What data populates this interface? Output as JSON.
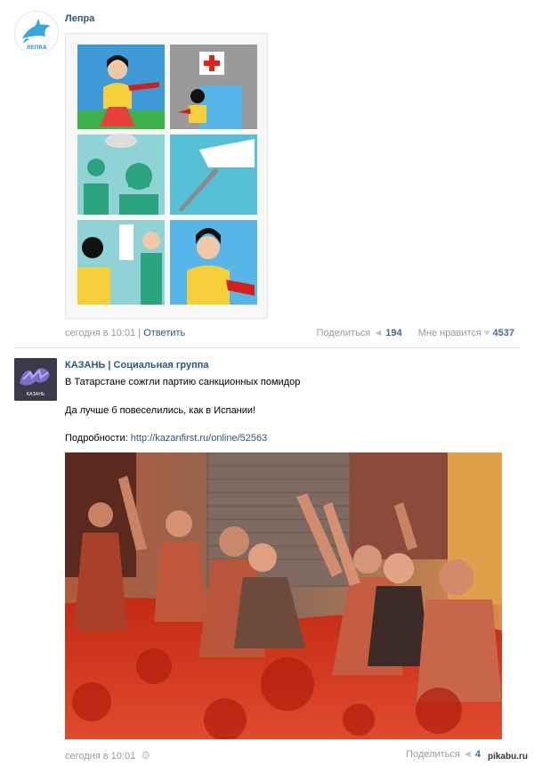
{
  "post1": {
    "author": "Лепра",
    "avatar_text": "ЛЕПRA",
    "time": "сегодня в 10:01",
    "separator": " | ",
    "reply": "Ответить",
    "share_label": "Поделиться",
    "share_count": "194",
    "like_label": "Мне нравится",
    "like_count": "4537"
  },
  "post2": {
    "author": "КАЗАНЬ | Социальная группа",
    "avatar_text": "КАЗАНЬ",
    "text1": "В Татарстане сожгли партию санкционных помидор",
    "text2": "Да лучше б повеселились, как в Испании!",
    "more_label": "Подробности: ",
    "more_url": "http://kazanfirst.ru/online/52563",
    "time": "сегодня в 10:01",
    "share_label": "Поделиться",
    "share_count": "4"
  },
  "watermark": "pikabu.ru",
  "colors": {
    "link": "#2b587a",
    "meta": "#999999",
    "divider": "#dae1e8",
    "tomato": "#c92a17"
  }
}
